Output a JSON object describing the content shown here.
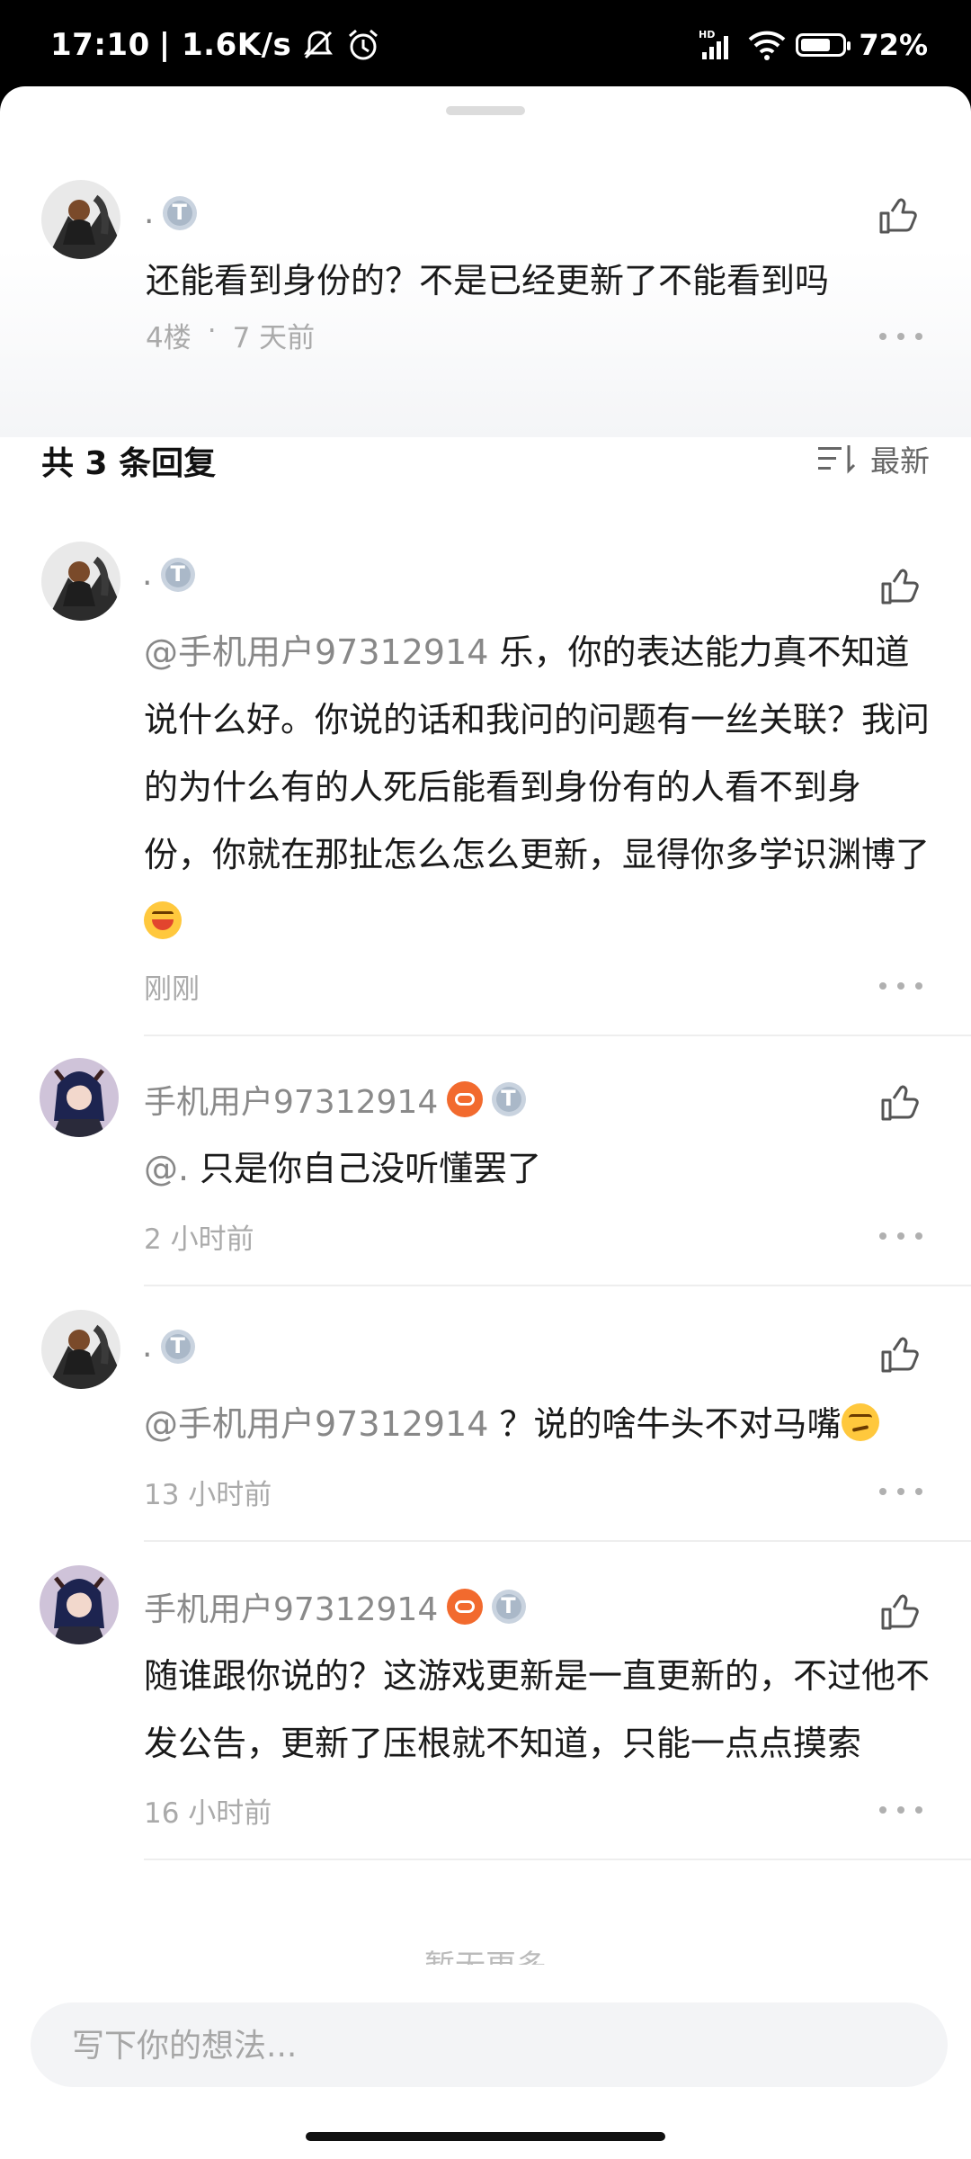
{
  "status_bar": {
    "time": "17:10",
    "net_speed": "| 1.6K/s",
    "battery": "72%",
    "battery_level": 0.72,
    "icons": [
      "mute-bell-icon",
      "alarm-icon",
      "hd-signal-icon",
      "wifi-icon",
      "battery-icon"
    ]
  },
  "main_comment": {
    "username": ".",
    "text": "还能看到身份的？不是已经更新了不能看到吗",
    "floor": "4楼",
    "dot": "·",
    "time": "7 天前"
  },
  "replies_header": {
    "count_label": "共 3 条回复",
    "sort_label": "最新"
  },
  "replies": [
    {
      "username": ".",
      "mention": "@手机用户97312914",
      "line1": " 乐，你的表达能力真不知道",
      "line2": "说什么好。你说的话和我问的问题有一丝关联？我问",
      "line3": "的为什么有的人死后能看到身份有的人看不到身",
      "line4": "份，你就在那扯怎么怎么更新，显得你多学识渊博了",
      "emoji": "laughing-emoji",
      "time": "刚刚"
    },
    {
      "username": "手机用户97312914",
      "mention": "@.",
      "text": " 只是你自己没听懂罢了",
      "time": "2 小时前"
    },
    {
      "username": ".",
      "mention": "@手机用户97312914",
      "text": " ？说的啥牛头不对马嘴",
      "emoji": "squint-emoji",
      "time": "13 小时前"
    },
    {
      "username": "手机用户97312914",
      "line1": "随谁跟你说的？这游戏更新是一直更新的，不过他不",
      "line2": "发公告，更新了压根就不知道，只能一点点摸索",
      "time": "16 小时前"
    }
  ],
  "load_more": "暂无更多",
  "input": {
    "placeholder": "写下你的想法..."
  }
}
